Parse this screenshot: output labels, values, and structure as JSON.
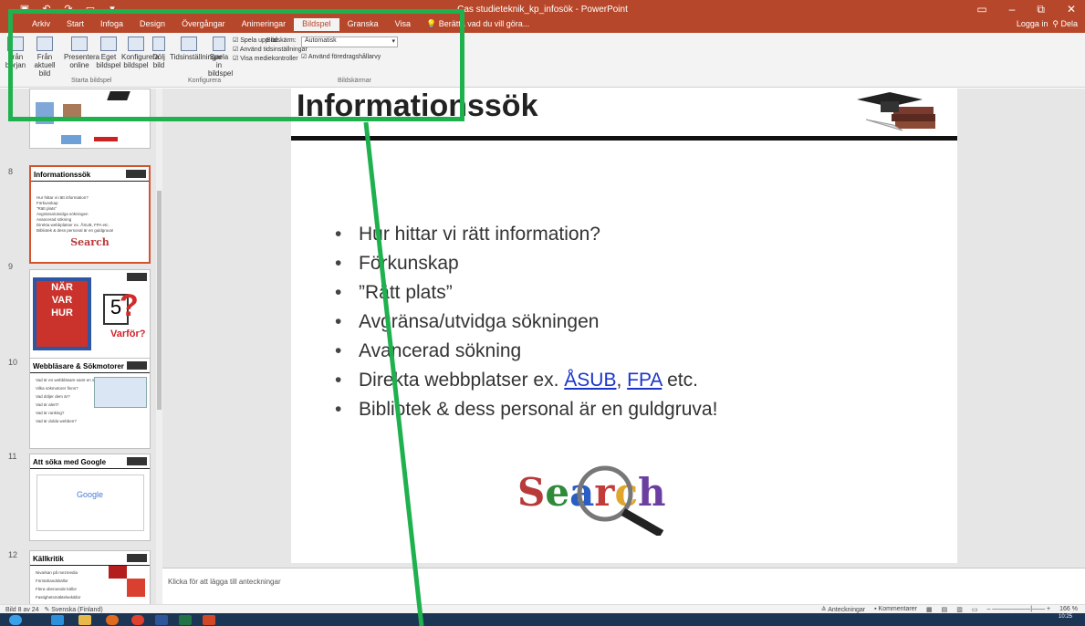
{
  "window": {
    "title": "Cas studieteknik_kp_infosök - PowerPoint",
    "signin": "Logga in",
    "share": "Dela",
    "controls": [
      "▭",
      "–",
      "⧉",
      "✕"
    ]
  },
  "tabs": [
    {
      "label": "Arkiv"
    },
    {
      "label": "Start"
    },
    {
      "label": "Infoga"
    },
    {
      "label": "Design"
    },
    {
      "label": "Övergångar"
    },
    {
      "label": "Animeringar"
    },
    {
      "label": "Bildspel"
    },
    {
      "label": "Granska"
    },
    {
      "label": "Visa"
    }
  ],
  "active_tab": "Bildspel",
  "tell_me": "Berätta vad du vill göra...",
  "ribbon": {
    "buttons": [
      {
        "label": "Från början"
      },
      {
        "label": "Från aktuell bild"
      },
      {
        "label": "Presentera online"
      },
      {
        "label": "Eget bildspel"
      },
      {
        "label": "Konfigurera bildspel"
      },
      {
        "label": "Dölj bild"
      },
      {
        "label": "Tidsinställningar"
      },
      {
        "label": "Spela in bildspel"
      }
    ],
    "checkboxes": [
      {
        "label": "Spela upp tal"
      },
      {
        "label": "Använd tidsinställningar"
      },
      {
        "label": "Visa mediekontroller"
      },
      {
        "label": "Använd föredragshållarvy"
      }
    ],
    "monitor_label": "Bildskärm:",
    "monitor_value": "Automatisk",
    "groups": [
      "Starta bildspel",
      "Konfigurera",
      "Bildskärmar"
    ]
  },
  "thumbnails": [
    {
      "number": "8",
      "title": "Informationssök",
      "items": [
        "Hur hittar vi rätt information?",
        "Förkunskap",
        "”Rätt plats”",
        "Avgränsa/utvidga sökningen",
        "Avancerad sökning",
        "Direkta webbplatser ex. ÅSUB, FPA etc.",
        "Bibliotek & dess personal är en guldgruva!"
      ],
      "logo": "Search"
    },
    {
      "number": "9",
      "lines": [
        "NÄR",
        "VAR",
        "HUR"
      ],
      "extra": "Varför?"
    },
    {
      "number": "10",
      "title": "Webbläsare & Sökmotorer",
      "items": [
        "Vad är en webbläsare samt en sökmotor?",
        "Vilka sökmotorer finns?",
        "Vad döljer dem är?",
        "Vad är alert?",
        "Vad är ranking?",
        "Vad är dolda webben?"
      ]
    },
    {
      "number": "11",
      "title": "Att söka med Google",
      "logo": "Google"
    },
    {
      "number": "12",
      "title": "Källkritik",
      "items": [
        "Nivarkan på mezmedia",
        "Förstahandskällor",
        "Flera oberoende källor",
        "Fastighetsmäktelsekällor"
      ]
    }
  ],
  "slide": {
    "title": "Informationssök",
    "bullets": [
      {
        "text": "Hur hittar vi rätt information?"
      },
      {
        "text": "Förkunskap"
      },
      {
        "text": "”Rätt plats”"
      },
      {
        "text": "Avgränsa/utvidga sökningen"
      },
      {
        "text": "Avancerad sökning"
      },
      {
        "prefix": "Direkta webbplatser ex. ",
        "link1": "ÅSUB",
        "sep": ", ",
        "link2": "FPA",
        "suffix": " etc."
      },
      {
        "text": "Bibliotek & dess personal är en guldgruva!"
      }
    ],
    "logo_letters": [
      "S",
      "e",
      "a",
      "r",
      "c",
      "h"
    ],
    "logo_colors": [
      "#b83a3a",
      "#2f8a3a",
      "#2a5ec4",
      "#c23b3b",
      "#e0a52a",
      "#6b3fa0"
    ]
  },
  "notes_placeholder": "Klicka för att lägga till anteckningar",
  "status": {
    "slide_of": "Bild 8 av 24",
    "language": "Svenska (Finland)",
    "notes": "Anteckningar",
    "comments": "Kommentarer",
    "zoom": "166 %"
  },
  "clock": {
    "time": "10:25"
  }
}
